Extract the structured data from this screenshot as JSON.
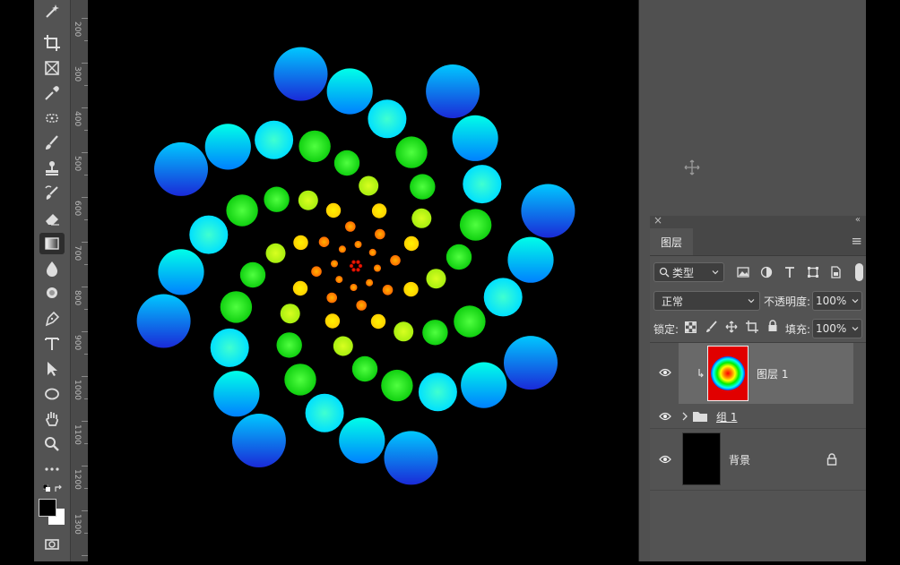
{
  "ruler": {
    "labels": [
      "200",
      "300",
      "400",
      "500",
      "600",
      "700",
      "800",
      "900",
      "1000",
      "1100",
      "1200",
      "1300"
    ]
  },
  "toolbar": {
    "tools": [
      "magic-wand",
      "crop",
      "frame",
      "eyedropper",
      "spot-healing",
      "brush",
      "clone-stamp",
      "history-brush",
      "eraser",
      "gradient",
      "blur",
      "dodge",
      "pen",
      "type",
      "path-selection",
      "ellipse",
      "hand",
      "zoom",
      "more"
    ],
    "active_tool": "gradient"
  },
  "layers_panel": {
    "close_glyph": "×",
    "collapse_glyph": "«",
    "tab_label": "图层",
    "menu_glyph": "≡",
    "filter_label": "类型",
    "blend_mode": "正常",
    "opacity_label": "不透明度:",
    "opacity_value": "100%",
    "lock_label": "锁定:",
    "fill_label": "填充:",
    "fill_value": "100%",
    "layers": [
      {
        "name": "图层 1",
        "visible": true,
        "selected": true
      },
      {
        "name": "组 1",
        "visible": true,
        "selected": false
      },
      {
        "name": "背景",
        "visible": true,
        "selected": false,
        "locked": true
      }
    ]
  },
  "colors": {
    "panel": "#535353",
    "selected_row": "#696969",
    "toolbar": "#535353"
  }
}
